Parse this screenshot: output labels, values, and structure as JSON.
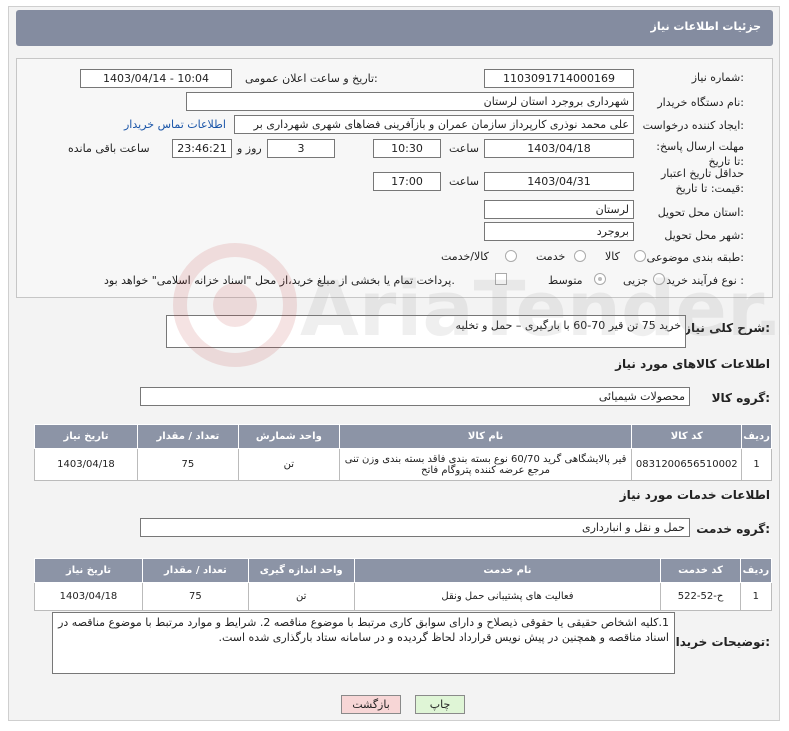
{
  "title": "جزئیات اطلاعات نیاز",
  "need_number": {
    "label": "شماره نیاز:",
    "value": "1103091714000169"
  },
  "announce": {
    "label": "تاریخ و ساعت اعلان عمومی:",
    "value": "1403/04/14 - 10:04"
  },
  "buyer": {
    "label": "نام دستگاه خریدار:",
    "value": "شهرداری بروجرد استان لرستان"
  },
  "creator": {
    "label": "ایجاد کننده درخواست:",
    "value": "علی محمد نوذری کارپرداز سازمان عمران و بازآفرینی فضاهای شهری شهرداری بر",
    "contact_link": "اطلاعات تماس خریدار"
  },
  "deadline": {
    "label": "مهلت ارسال پاسخ: تا تاریخ:",
    "date": "1403/04/18",
    "time_label": "ساعت",
    "time": "10:30",
    "days": "3",
    "days_label": "روز و",
    "remaining": "23:46:21",
    "remaining_label": "ساعت باقی مانده"
  },
  "price_validity": {
    "label": "حداقل تاریخ اعتبار قیمت: تا تاریخ:",
    "date": "1403/04/31",
    "time_label": "ساعت",
    "time": "17:00"
  },
  "province": {
    "label": "استان محل تحویل:",
    "value": "لرستان"
  },
  "city": {
    "label": "شهر محل تحویل:",
    "value": "بروجرد"
  },
  "category": {
    "label": "طبقه بندی موضوعی:",
    "options": [
      "کالا",
      "خدمت",
      "کالا/خدمت"
    ]
  },
  "process": {
    "label": "نوع فرآیند خرید :",
    "options": [
      "جزیی",
      "متوسط"
    ],
    "note": "پرداخت تمام یا بخشی از مبلغ خرید،از محل \"اسناد خزانه اسلامی\" خواهد بود."
  },
  "description": {
    "label": "شرح کلی نیاز:",
    "value": "خرید 75 تن قیر 70-60 با بارگیری – حمل و تخلیه"
  },
  "goods_section": {
    "title": "اطلاعات کالاهای مورد نیاز",
    "group_label": "گروه کالا:",
    "group_value": "محصولات شیمیائی"
  },
  "goods_table": {
    "headers": [
      "ردیف",
      "کد کالا",
      "نام کالا",
      "واحد شمارش",
      "تعداد / مقدار",
      "تاریخ نیاز"
    ],
    "rows": [
      {
        "row": "1",
        "code": "0831200656510002",
        "name": "قیر پالایشگاهی گرید 60/70 نوع بسته بندی فاقد بسته بندی وزن تنی مرجع عرضه کننده پتروگام فاتح",
        "unit": "تن",
        "qty": "75",
        "date": "1403/04/18"
      }
    ]
  },
  "services_section": {
    "title": "اطلاعات خدمات مورد نیاز",
    "group_label": "گروه خدمت:",
    "group_value": "حمل و نقل و انبارداری"
  },
  "services_table": {
    "headers": [
      "ردیف",
      "کد خدمت",
      "نام خدمت",
      "واحد اندازه گیری",
      "تعداد / مقدار",
      "تاریخ نیاز"
    ],
    "rows": [
      {
        "row": "1",
        "code": "ح-52-522",
        "name": "فعالیت های پشتیبانی حمل ونقل",
        "unit": "تن",
        "qty": "75",
        "date": "1403/04/18"
      }
    ]
  },
  "buyer_notes": {
    "label": "توضیحات خریدار:",
    "value": "1.کلیه اشخاص حقیقی یا حقوقی ذیصلاح و دارای سوابق کاری مرتبط با موضوع مناقصه 2. شرایط و موارد مرتبط با موضوع مناقصه در اسناد مناقصه  و همچنین در پیش نویس قرارداد لحاظ گردیده و در سامانه ستاد بارگذاری شده است."
  },
  "buttons": {
    "print": "چاپ",
    "back": "بازگشت"
  },
  "watermark": "AriaTender.neT",
  "colors": {
    "header_bg": "#848ca0",
    "table_header_bg": "#8c94a6",
    "print_btn": "#dff5d6",
    "back_btn": "#f7d6d6",
    "link": "#1a55a8"
  }
}
